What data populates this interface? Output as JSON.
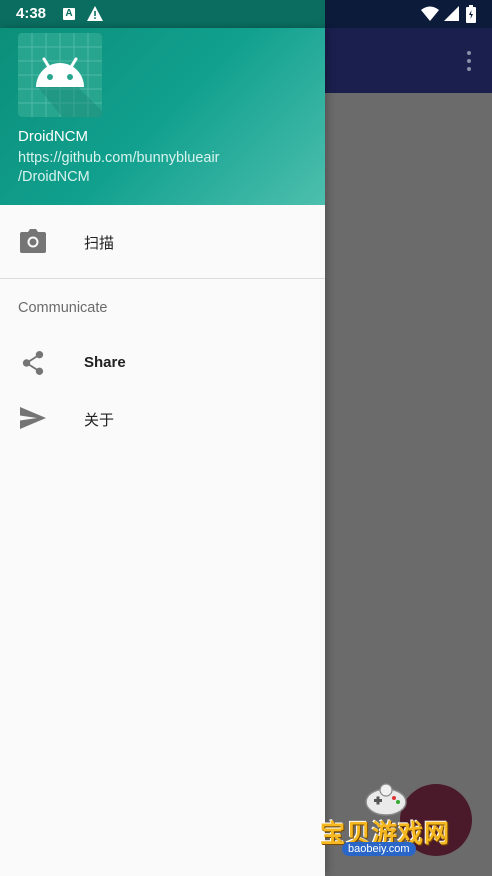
{
  "status_bar": {
    "time": "4:38",
    "a_icon_letter": "A"
  },
  "drawer": {
    "header": {
      "title": "DroidNCM",
      "subtitle": "https://github.com/bunnyblueair\n/DroidNCM"
    },
    "items": [
      {
        "label": "扫描",
        "icon": "camera-icon"
      },
      {
        "label": "Share",
        "icon": "share-icon"
      },
      {
        "label": "关于",
        "icon": "send-icon"
      }
    ],
    "section_header": "Communicate"
  },
  "watermark": {
    "text": "宝贝游戏网",
    "url": "baobeiy.com"
  },
  "colors": {
    "header_start": "#0b8f7a",
    "header_end": "#4dbfae",
    "toolbar": "#1a1f4e",
    "scrim": "#6b6b6b"
  }
}
